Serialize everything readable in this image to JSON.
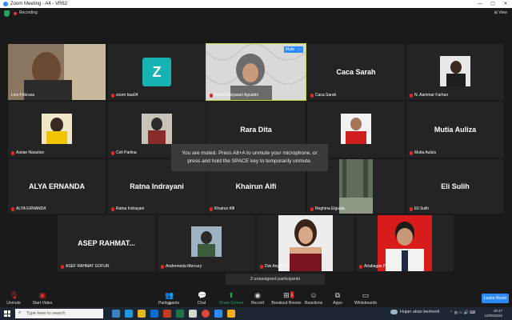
{
  "window": {
    "title": "Zoom Meeting - A4 - VR62",
    "controls": [
      "—",
      "▢",
      "✕"
    ]
  },
  "top": {
    "recording_label": "Recording",
    "view_label": "⊞ View"
  },
  "tiles": [
    {
      "name": "Livo Februsa"
    },
    {
      "name": "zoom baa04",
      "initial": "Z"
    },
    {
      "name": "Prima Mulyasari Agustini",
      "mute_tag": "Mute",
      "more_tag": "···"
    },
    {
      "name": "Caca Sarah",
      "center": "Caca Sarah"
    },
    {
      "name": "N. Aammar Farhan"
    },
    {
      "name": "Asrian Nasution"
    },
    {
      "name": "Celi Parlina"
    },
    {
      "name": "Rara Dita",
      "center": "Rara Dita"
    },
    {
      "name": "Pandu",
      "partial": "ra"
    },
    {
      "name": "Mutia Auliza",
      "center": "Mutia Auliza"
    },
    {
      "name": "ALYA ERNANDA",
      "center": "ALYA ERNANDA"
    },
    {
      "name": "Ratna Indrayani",
      "center": "Ratna Indrayani"
    },
    {
      "name": "Khairun Alfi",
      "center": "Khairun Alfi"
    },
    {
      "name": "Reghina Elgusta"
    },
    {
      "name": "Eli Sulih",
      "center": "Eli Sulih"
    },
    {
      "name": "ASEF RAHMAT GOFUR",
      "center": "ASEP RAHMAT..."
    },
    {
      "name": "Andromeda Mercury"
    },
    {
      "name": "Dwi Angga"
    },
    {
      "name": "Ariabagas P"
    }
  ],
  "toast": {
    "line1": "You are muted. Press Alt+A to unmute your microphone, or",
    "line2": "press and hold the SPACE key to temporarily unmute."
  },
  "unassigned": "2 unassigned participants",
  "toolbar": {
    "unmute": "Unmute",
    "start_video": "Start Video",
    "participants": "Participants",
    "participants_count": "19",
    "chat": "Chat",
    "share_screen": "Share Screen",
    "record": "Record",
    "breakout_rooms": "Breakout Rooms",
    "breakout_badge": "1",
    "reactions": "Reactions",
    "apps": "Apps",
    "whiteboards": "Whiteboards",
    "leave": "Leave Room"
  },
  "taskbar": {
    "search_placeholder": "Type here to search",
    "weather": "Hujan akan berhenti",
    "time": "18:47",
    "date": "12/06/2022"
  },
  "colors": {
    "accent": "#2d8cff",
    "speaker": "#c9d43a",
    "muted": "#e02828",
    "share": "#23a55a"
  }
}
